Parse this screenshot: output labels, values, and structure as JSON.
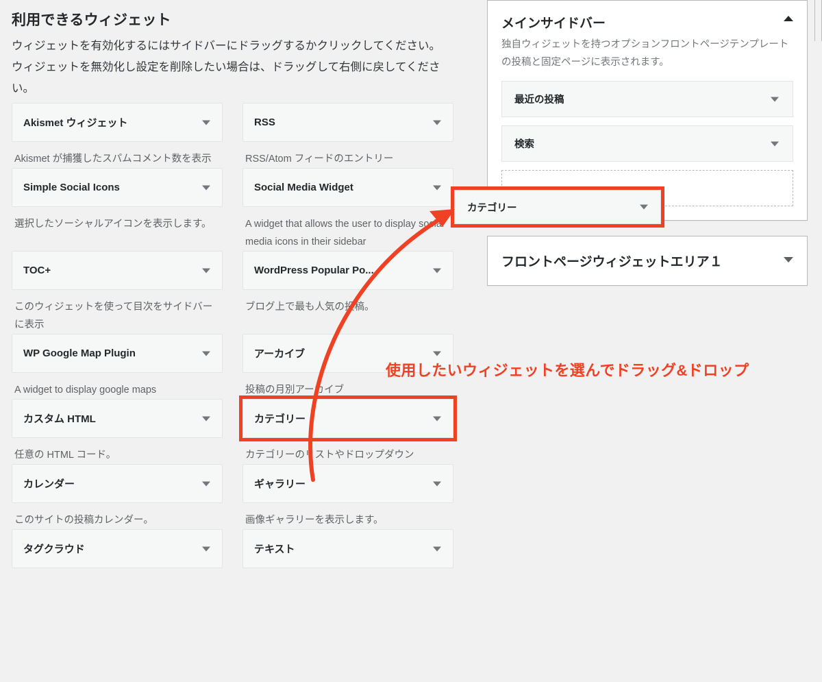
{
  "available": {
    "title": "利用できるウィジェット",
    "description": "ウィジェットを有効化するにはサイドバーにドラッグするかクリックしてください。ウィジェットを無効化し設定を削除したい場合は、ドラッグして右側に戻してください。",
    "widgets": [
      {
        "name": "Akismet ウィジェット",
        "desc": "Akismet が捕獲したスパムコメント数を表示",
        "highlighted": false
      },
      {
        "name": "RSS",
        "desc": "RSS/Atom フィードのエントリー",
        "highlighted": false
      },
      {
        "name": "Simple Social Icons",
        "desc": "選択したソーシャルアイコンを表示します。",
        "highlighted": false
      },
      {
        "name": "Social Media Widget",
        "desc": "A widget that allows the user to display social media icons in their sidebar",
        "highlighted": false
      },
      {
        "name": "TOC+",
        "desc": "このウィジェットを使って目次をサイドバーに表示",
        "highlighted": false
      },
      {
        "name": "WordPress Popular Po...",
        "desc": "ブログ上で最も人気の投稿。",
        "highlighted": false
      },
      {
        "name": "WP Google Map Plugin",
        "desc": "A widget to display google maps",
        "highlighted": false
      },
      {
        "name": "アーカイブ",
        "desc": "投稿の月別アーカイブ",
        "highlighted": false
      },
      {
        "name": "カスタム HTML",
        "desc": "任意の HTML コード。",
        "highlighted": false
      },
      {
        "name": "カテゴリー",
        "desc": "カテゴリーのリストやドロップダウン",
        "highlighted": true
      },
      {
        "name": "カレンダー",
        "desc": "このサイトの投稿カレンダー。",
        "highlighted": false
      },
      {
        "name": "ギャラリー",
        "desc": "画像ギャラリーを表示します。",
        "highlighted": false
      },
      {
        "name": "タグクラウド",
        "desc": "",
        "highlighted": false
      },
      {
        "name": "テキスト",
        "desc": "",
        "highlighted": false
      }
    ]
  },
  "sidebar_panels": {
    "main": {
      "title": "メインサイドバー",
      "description": "独自ウィジェットを持つオプションフロントページテンプレートの投稿と固定ページに表示されます。",
      "toggle_icon": "chevron-up-icon",
      "widgets": [
        {
          "name": "最近の投稿"
        },
        {
          "name": "検索"
        }
      ],
      "placeholder_visible": true
    },
    "front_page_area_1": {
      "title": "フロントページウィジェットエリア１",
      "toggle_icon": "chevron-down-icon"
    }
  },
  "dragged_widget": {
    "name": "カテゴリー",
    "caret_icon": "chevron-down-icon"
  },
  "annotation": {
    "text": "使用したいウィジェットを選んでドラッグ&ドロップ",
    "arrow_icon": "curved-arrow-icon"
  },
  "colors": {
    "accent": "#ef4123",
    "page_bg": "#f1f1f1",
    "panel_bg": "#ffffff",
    "widget_bg": "#f6f7f7",
    "text": "#23282d",
    "muted_text": "#72777c"
  }
}
